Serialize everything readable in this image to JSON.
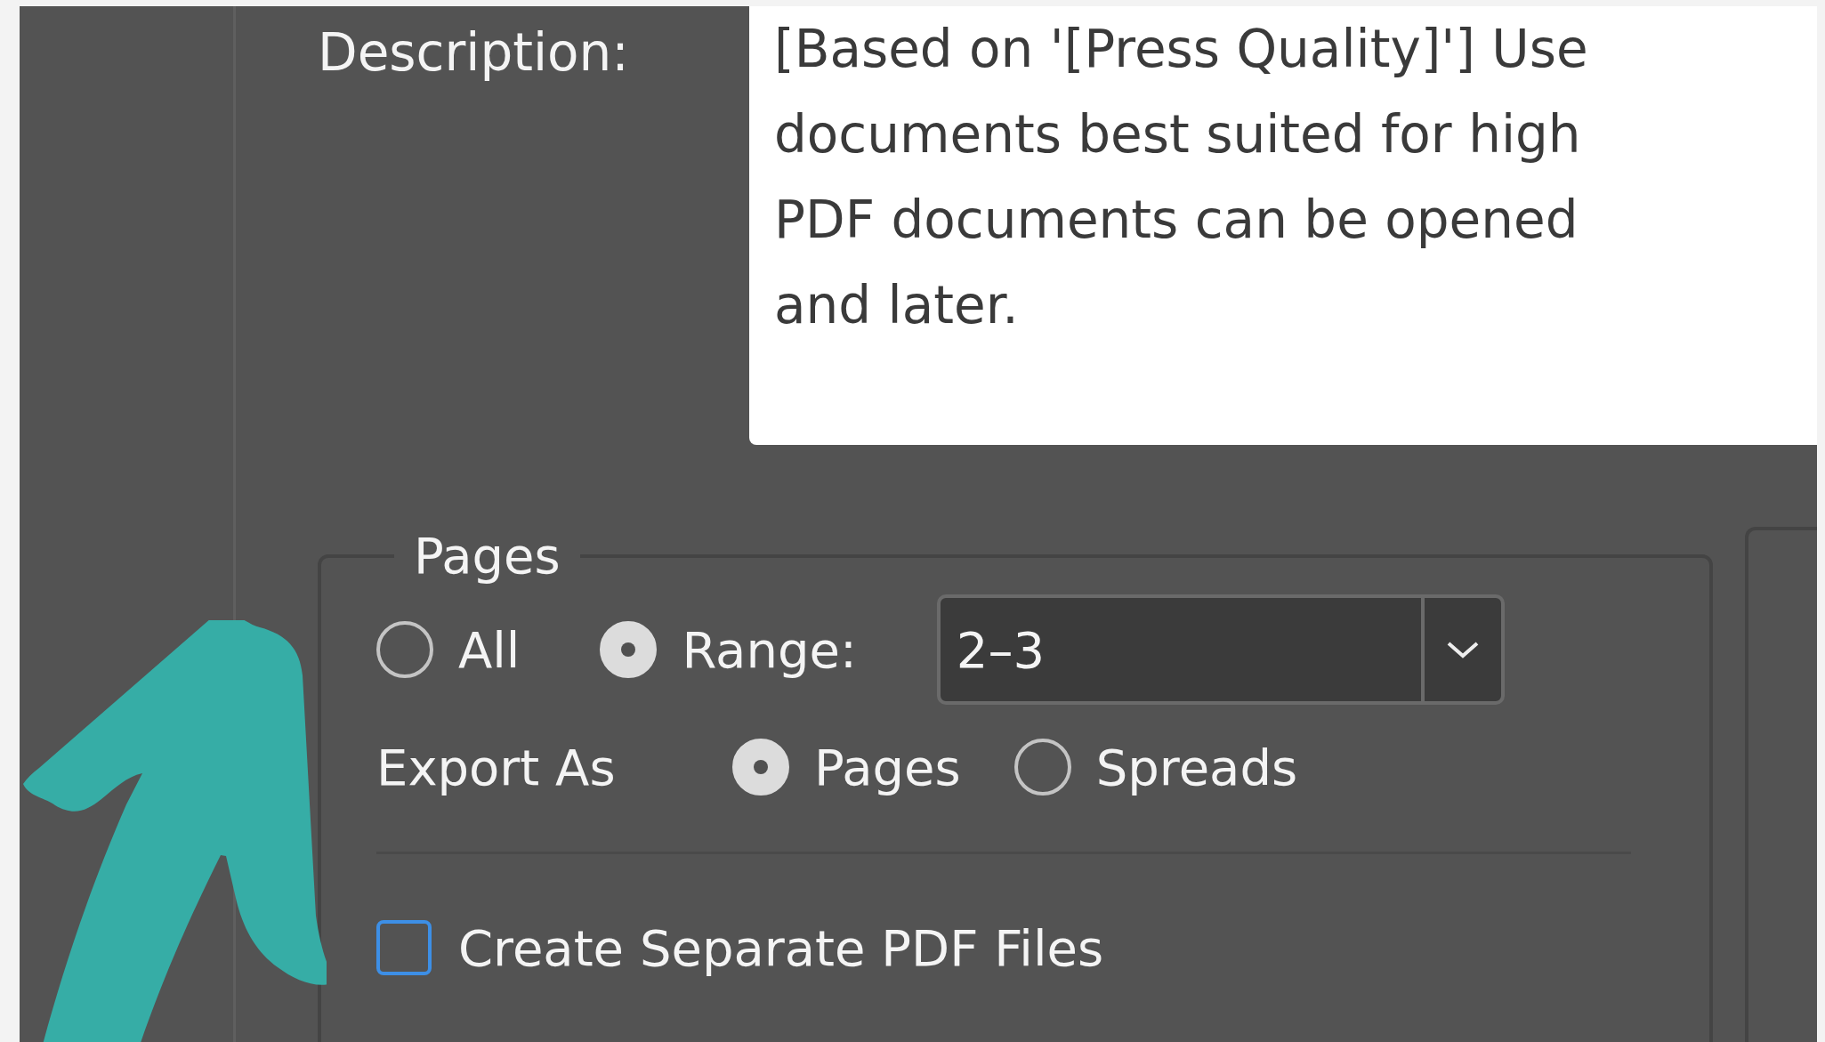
{
  "description": {
    "label": "Description:",
    "value": "[Based on '[Press Quality]'] Use\ndocuments best suited for high\nPDF documents can be opened\nand later."
  },
  "pages": {
    "title": "Pages",
    "range_options": [
      {
        "label": "All",
        "selected": false
      },
      {
        "label": "Range:",
        "selected": true
      }
    ],
    "range_value": "2–3",
    "export_as": {
      "label": "Export As",
      "options": [
        {
          "label": "Pages",
          "selected": true
        },
        {
          "label": "Spreads",
          "selected": false
        }
      ]
    },
    "separate_files": {
      "label": "Create Separate PDF Files",
      "checked": false
    }
  }
}
